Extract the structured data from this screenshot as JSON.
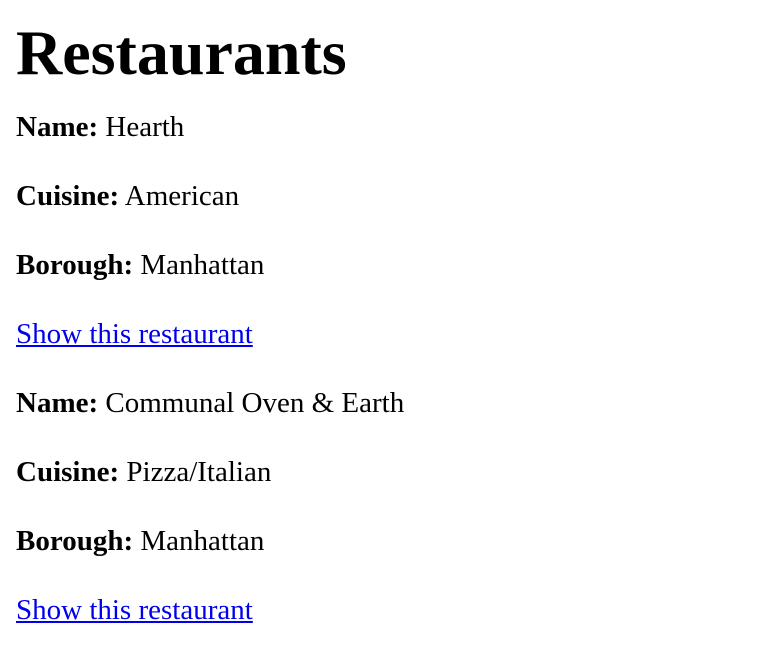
{
  "page": {
    "title": "Restaurants"
  },
  "labels": {
    "name": "Name:",
    "cuisine": "Cuisine:",
    "borough": "Borough:"
  },
  "restaurants": [
    {
      "name": "Hearth",
      "cuisine": "American",
      "borough": "Manhattan",
      "link_label": "Show this restaurant"
    },
    {
      "name": "Communal Oven & Earth",
      "cuisine": "Pizza/Italian",
      "borough": "Manhattan",
      "link_label": "Show this restaurant"
    }
  ],
  "colors": {
    "link": "#0000ee",
    "text": "#000000",
    "background": "#ffffff"
  }
}
